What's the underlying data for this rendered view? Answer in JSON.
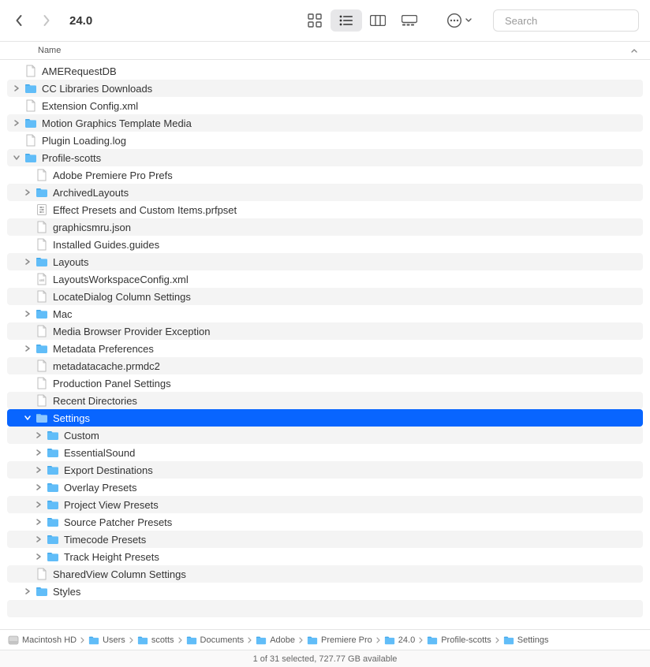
{
  "toolbar": {
    "title": "24.0",
    "search_placeholder": "Search"
  },
  "columns": {
    "name": "Name"
  },
  "rows": [
    {
      "indent": 0,
      "icon": "file",
      "name": "AMERequestDB",
      "disclosure": "none",
      "alt": false,
      "selected": false
    },
    {
      "indent": 0,
      "icon": "folder",
      "name": "CC Libraries Downloads",
      "disclosure": "closed",
      "alt": true,
      "selected": false
    },
    {
      "indent": 0,
      "icon": "file",
      "name": "Extension Config.xml",
      "disclosure": "none",
      "alt": false,
      "selected": false
    },
    {
      "indent": 0,
      "icon": "folder",
      "name": "Motion Graphics Template Media",
      "disclosure": "closed",
      "alt": true,
      "selected": false
    },
    {
      "indent": 0,
      "icon": "file",
      "name": "Plugin Loading.log",
      "disclosure": "none",
      "alt": false,
      "selected": false
    },
    {
      "indent": 0,
      "icon": "folder",
      "name": "Profile-scotts",
      "disclosure": "open",
      "alt": true,
      "selected": false
    },
    {
      "indent": 1,
      "icon": "file",
      "name": "Adobe Premiere Pro Prefs",
      "disclosure": "none",
      "alt": false,
      "selected": false
    },
    {
      "indent": 1,
      "icon": "folder",
      "name": "ArchivedLayouts",
      "disclosure": "closed",
      "alt": true,
      "selected": false
    },
    {
      "indent": 1,
      "icon": "preset",
      "name": "Effect Presets and Custom Items.prfpset",
      "disclosure": "none",
      "alt": false,
      "selected": false
    },
    {
      "indent": 1,
      "icon": "file",
      "name": "graphicsmru.json",
      "disclosure": "none",
      "alt": true,
      "selected": false
    },
    {
      "indent": 1,
      "icon": "file",
      "name": "Installed Guides.guides",
      "disclosure": "none",
      "alt": false,
      "selected": false
    },
    {
      "indent": 1,
      "icon": "folder",
      "name": "Layouts",
      "disclosure": "closed",
      "alt": true,
      "selected": false
    },
    {
      "indent": 1,
      "icon": "xml",
      "name": "LayoutsWorkspaceConfig.xml",
      "disclosure": "none",
      "alt": false,
      "selected": false
    },
    {
      "indent": 1,
      "icon": "file",
      "name": "LocateDialog Column Settings",
      "disclosure": "none",
      "alt": true,
      "selected": false
    },
    {
      "indent": 1,
      "icon": "folder",
      "name": "Mac",
      "disclosure": "closed",
      "alt": false,
      "selected": false
    },
    {
      "indent": 1,
      "icon": "file",
      "name": "Media Browser Provider Exception",
      "disclosure": "none",
      "alt": true,
      "selected": false
    },
    {
      "indent": 1,
      "icon": "folder",
      "name": "Metadata Preferences",
      "disclosure": "closed",
      "alt": false,
      "selected": false
    },
    {
      "indent": 1,
      "icon": "file",
      "name": "metadatacache.prmdc2",
      "disclosure": "none",
      "alt": true,
      "selected": false
    },
    {
      "indent": 1,
      "icon": "file",
      "name": "Production Panel Settings",
      "disclosure": "none",
      "alt": false,
      "selected": false
    },
    {
      "indent": 1,
      "icon": "file",
      "name": "Recent Directories",
      "disclosure": "none",
      "alt": true,
      "selected": false
    },
    {
      "indent": 1,
      "icon": "folder",
      "name": "Settings",
      "disclosure": "open",
      "alt": false,
      "selected": true
    },
    {
      "indent": 2,
      "icon": "folder",
      "name": "Custom",
      "disclosure": "closed",
      "alt": true,
      "selected": false
    },
    {
      "indent": 2,
      "icon": "folder",
      "name": "EssentialSound",
      "disclosure": "closed",
      "alt": false,
      "selected": false
    },
    {
      "indent": 2,
      "icon": "folder",
      "name": "Export Destinations",
      "disclosure": "closed",
      "alt": true,
      "selected": false
    },
    {
      "indent": 2,
      "icon": "folder",
      "name": "Overlay Presets",
      "disclosure": "closed",
      "alt": false,
      "selected": false
    },
    {
      "indent": 2,
      "icon": "folder",
      "name": "Project View Presets",
      "disclosure": "closed",
      "alt": true,
      "selected": false
    },
    {
      "indent": 2,
      "icon": "folder",
      "name": "Source Patcher Presets",
      "disclosure": "closed",
      "alt": false,
      "selected": false
    },
    {
      "indent": 2,
      "icon": "folder",
      "name": "Timecode Presets",
      "disclosure": "closed",
      "alt": true,
      "selected": false
    },
    {
      "indent": 2,
      "icon": "folder",
      "name": "Track Height Presets",
      "disclosure": "closed",
      "alt": false,
      "selected": false
    },
    {
      "indent": 1,
      "icon": "file",
      "name": "SharedView Column Settings",
      "disclosure": "none",
      "alt": true,
      "selected": false
    },
    {
      "indent": 1,
      "icon": "folder",
      "name": "Styles",
      "disclosure": "closed",
      "alt": false,
      "selected": false
    },
    {
      "indent": 0,
      "icon": "blank",
      "name": "",
      "disclosure": "none",
      "alt": true,
      "selected": false
    }
  ],
  "path": [
    {
      "icon": "disk",
      "label": "Macintosh HD"
    },
    {
      "icon": "folder",
      "label": "Users"
    },
    {
      "icon": "folder",
      "label": "scotts"
    },
    {
      "icon": "folder",
      "label": "Documents"
    },
    {
      "icon": "folder",
      "label": "Adobe"
    },
    {
      "icon": "folder",
      "label": "Premiere Pro"
    },
    {
      "icon": "folder",
      "label": "24.0"
    },
    {
      "icon": "folder",
      "label": "Profile-scotts"
    },
    {
      "icon": "folder",
      "label": "Settings"
    }
  ],
  "status": "1 of 31 selected, 727.77 GB available"
}
